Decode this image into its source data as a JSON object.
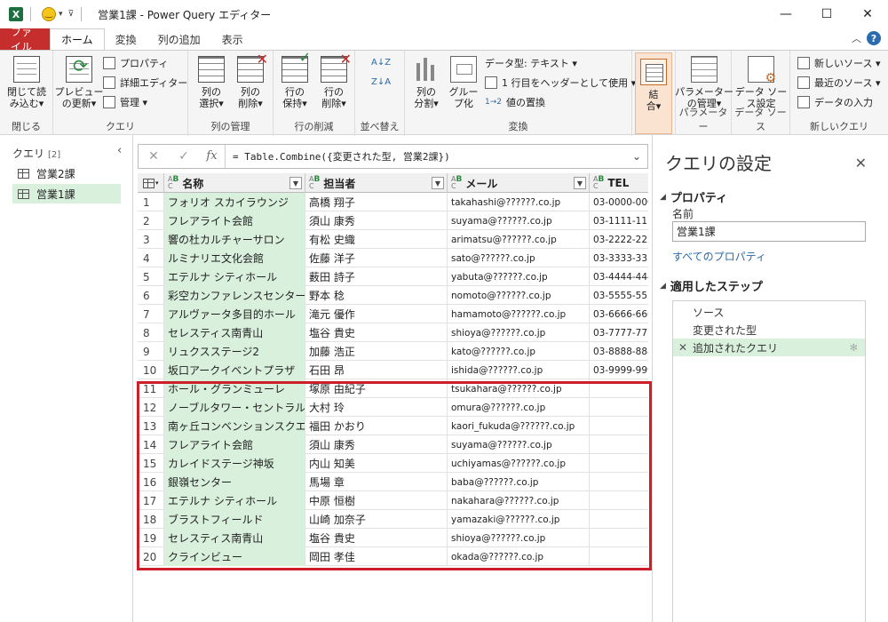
{
  "window": {
    "title": "営業1課 - Power Query エディター",
    "minimize_glyph": "—",
    "maximize_glyph": "☐",
    "close_glyph": "✕"
  },
  "ribbon_tabs": [
    "ファイル",
    "ホーム",
    "変換",
    "列の追加",
    "表示"
  ],
  "ribbon": {
    "close": {
      "btn": "閉じて読\nみ込む▾",
      "label": "閉じる"
    },
    "query": {
      "preview": "プレビュー\nの更新▾",
      "properties": "プロパティ",
      "advanced_editor": "詳細エディター",
      "manage": "管理 ▾",
      "label": "クエリ"
    },
    "columns": {
      "choose": "列の\n選択▾",
      "remove": "列の\n削除▾",
      "label": "列の管理"
    },
    "rows": {
      "keep": "行の\n保持▾",
      "remove": "行の\n削除▾",
      "label": "行の削減"
    },
    "sort": {
      "label": "並べ替え",
      "asc_glyph": "A↓Z",
      "desc_glyph": "Z↓A"
    },
    "transform": {
      "split": "列の\n分割▾",
      "group": "グルー\nプ化",
      "data_type": "データ型: テキスト ▾",
      "use_header": "1 行目をヘッダーとして使用 ▾",
      "replace": "値の置換",
      "label": "変換"
    },
    "combine": {
      "btn": "結\n合▾"
    },
    "params": {
      "manage": "パラメーター\nの管理▾",
      "label": "パラメーター"
    },
    "datasource": {
      "settings": "データ ソー\nス設定",
      "label": "データ ソース"
    },
    "newquery": {
      "new_source": "新しいソース ▾",
      "recent_source": "最近のソース ▾",
      "enter_data": "データの入力",
      "label": "新しいクエリ"
    }
  },
  "query_pane": {
    "title": "クエリ",
    "count": "[2]",
    "items": [
      "営業2課",
      "営業1課"
    ]
  },
  "formula_bar": {
    "cancel_glyph": "✕",
    "commit_glyph": "✓",
    "fx_label": "fx",
    "expand_glyph": "⌄",
    "formula": "= Table.Combine({変更された型, 営業2課})"
  },
  "table": {
    "headers": [
      "名称",
      "担当者",
      "メール",
      "TEL"
    ],
    "rows": [
      [
        "1",
        "フォリオ スカイラウンジ",
        "高橋 翔子",
        "takahashi@??????.co.jp",
        "03-0000-000"
      ],
      [
        "2",
        "フレアライト会館",
        "須山 康秀",
        "suyama@??????.co.jp",
        "03-1111-111"
      ],
      [
        "3",
        "響の杜カルチャーサロン",
        "有松 史織",
        "arimatsu@??????.co.jp",
        "03-2222-222"
      ],
      [
        "4",
        "ルミナリエ文化会館",
        "佐藤 洋子",
        "sato@??????.co.jp",
        "03-3333-333"
      ],
      [
        "5",
        "エテルナ シティホール",
        "薮田 詩子",
        "yabuta@??????.co.jp",
        "03-4444-444"
      ],
      [
        "6",
        "彩空カンファレンスセンター",
        "野本 稔",
        "nomoto@??????.co.jp",
        "03-5555-555"
      ],
      [
        "7",
        "アルヴァータ多目的ホール",
        "滝元 優作",
        "hamamoto@??????.co.jp",
        "03-6666-666"
      ],
      [
        "8",
        "セレスティス南青山",
        "塩谷 貴史",
        "shioya@??????.co.jp",
        "03-7777-777"
      ],
      [
        "9",
        "リュクスステージ2",
        "加藤 浩正",
        "kato@??????.co.jp",
        "03-8888-888"
      ],
      [
        "10",
        "坂口アークイベントプラザ",
        "石田 昂",
        "ishida@??????.co.jp",
        "03-9999-999"
      ],
      [
        "11",
        "ホール・グランミューレ",
        "塚原 由紀子",
        "tsukahara@??????.co.jp",
        ""
      ],
      [
        "12",
        "ノーブルタワー・セントラルホ...",
        "大村 玲",
        "omura@??????.co.jp",
        ""
      ],
      [
        "13",
        "南ヶ丘コンベンションスクエア",
        "福田 かおり",
        "kaori_fukuda@??????.co.jp",
        ""
      ],
      [
        "14",
        "フレアライト会館",
        "須山 康秀",
        "suyama@??????.co.jp",
        ""
      ],
      [
        "15",
        "カレイドステージ神坂",
        "内山 知美",
        "uchiyamas@??????.co.jp",
        ""
      ],
      [
        "16",
        "銀嶺センター",
        "馬場 章",
        "baba@??????.co.jp",
        ""
      ],
      [
        "17",
        "エテルナ シティホール",
        "中原 恒樹",
        "nakahara@??????.co.jp",
        ""
      ],
      [
        "18",
        "ブラストフィールド",
        "山崎 加奈子",
        "yamazaki@??????.co.jp",
        ""
      ],
      [
        "19",
        "セレスティス南青山",
        "塩谷 貴史",
        "shioya@??????.co.jp",
        ""
      ],
      [
        "20",
        "クラインビュー",
        "岡田 孝佳",
        "okada@??????.co.jp",
        ""
      ]
    ]
  },
  "settings_pane": {
    "title": "クエリの設定",
    "properties_header": "プロパティ",
    "name_label": "名前",
    "name_value": "営業1課",
    "all_properties_link": "すべてのプロパティ",
    "steps_header": "適用したステップ",
    "steps": [
      "ソース",
      "変更された型",
      "追加されたクエリ"
    ]
  },
  "colors": {
    "file_tab": "#c62d2d",
    "selection": "#d9f0dd",
    "highlight_box": "#cc1f2a"
  }
}
